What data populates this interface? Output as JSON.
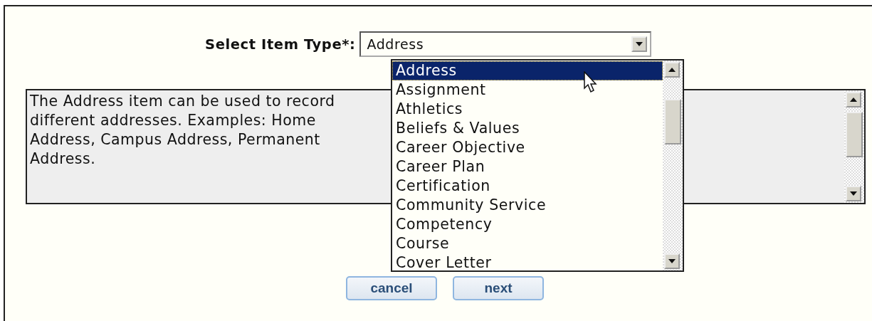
{
  "form": {
    "label": "Select Item Type*:",
    "select": {
      "value": "Address"
    }
  },
  "options": [
    {
      "label": "Address",
      "selected": true
    },
    {
      "label": "Assignment",
      "selected": false
    },
    {
      "label": "Athletics",
      "selected": false
    },
    {
      "label": "Beliefs & Values",
      "selected": false
    },
    {
      "label": "Career Objective",
      "selected": false
    },
    {
      "label": "Career Plan",
      "selected": false
    },
    {
      "label": "Certification",
      "selected": false
    },
    {
      "label": "Community Service",
      "selected": false
    },
    {
      "label": "Competency",
      "selected": false
    },
    {
      "label": "Course",
      "selected": false
    },
    {
      "label": "Cover Letter",
      "selected": false
    }
  ],
  "description": "The Address item can be used to record different addresses. Examples: Home Address, Campus Address, Permanent Address.",
  "buttons": [
    "cancel",
    "next"
  ]
}
